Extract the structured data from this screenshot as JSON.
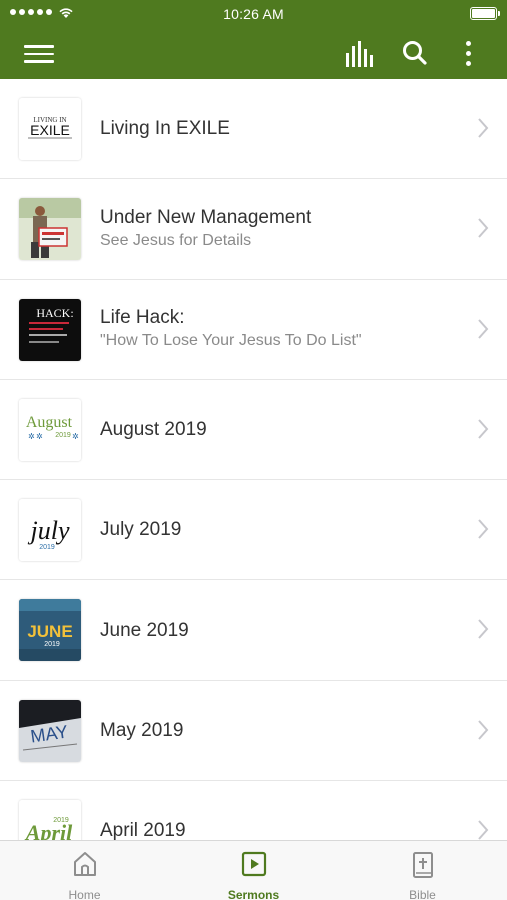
{
  "status_bar": {
    "time": "10:26 AM"
  },
  "app_bar": {
    "icons": [
      "menu-icon",
      "equalizer-icon",
      "search-icon",
      "more-vert-icon"
    ],
    "accent_color": "#4f7a1f"
  },
  "sermons": [
    {
      "title": "Living In EXILE",
      "subtitle": "",
      "thumb": "exile"
    },
    {
      "title": "Under New Management",
      "subtitle": "See Jesus for Details",
      "thumb": "management"
    },
    {
      "title": "Life Hack:",
      "subtitle": "\"How To Lose Your Jesus To Do List\"",
      "thumb": "lifehack"
    },
    {
      "title": "August 2019",
      "subtitle": "",
      "thumb": "august"
    },
    {
      "title": "July 2019",
      "subtitle": "",
      "thumb": "july"
    },
    {
      "title": "June 2019",
      "subtitle": "",
      "thumb": "june"
    },
    {
      "title": "May 2019",
      "subtitle": "",
      "thumb": "may"
    },
    {
      "title": "April 2019",
      "subtitle": "",
      "thumb": "april"
    }
  ],
  "thumb_text": {
    "exile_small": "LIVING IN",
    "exile_big": "EXILE",
    "lifehack": "HACK:",
    "august": "August",
    "august_year": "2019",
    "july": "july",
    "july_year": "2019",
    "june": "JUNE",
    "june_year": "2019",
    "may": "MAY",
    "april": "April",
    "april_year": "2019"
  },
  "tabs": [
    {
      "label": "Home",
      "icon": "home-icon",
      "active": false
    },
    {
      "label": "Sermons",
      "icon": "play-square-icon",
      "active": true
    },
    {
      "label": "Bible",
      "icon": "bible-icon",
      "active": false
    }
  ]
}
